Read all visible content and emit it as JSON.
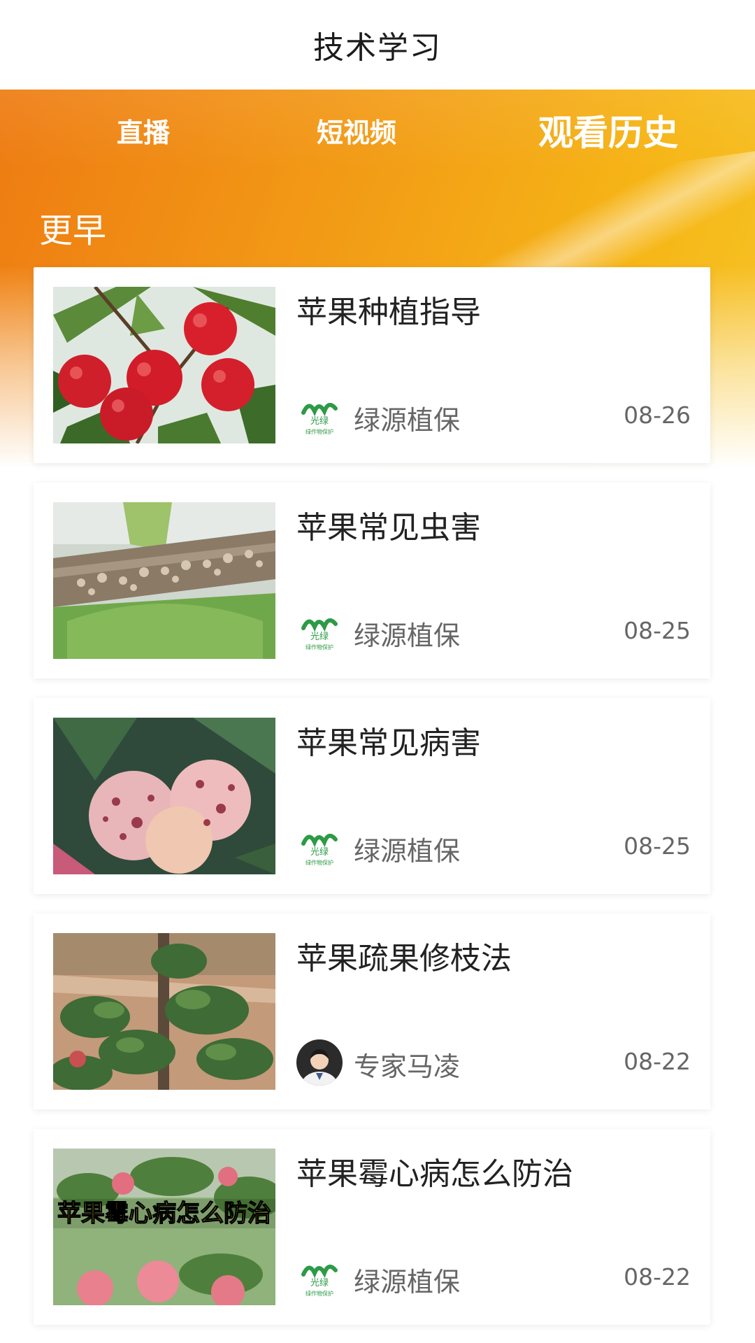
{
  "header": {
    "title": "技术学习"
  },
  "tabs": [
    {
      "label": "直播"
    },
    {
      "label": "短视频"
    },
    {
      "label": "观看历史",
      "active": true
    }
  ],
  "section": {
    "label": "更早"
  },
  "videos": [
    {
      "title": "苹果种植指导",
      "author": "绿源植保",
      "author_icon": "lvyuan-logo",
      "date": "08-26",
      "thumbnail": "red-apples-on-branch"
    },
    {
      "title": "苹果常见虫害",
      "author": "绿源植保",
      "author_icon": "lvyuan-logo",
      "date": "08-25",
      "thumbnail": "branch-with-scale-insects"
    },
    {
      "title": "苹果常见病害",
      "author": "绿源植保",
      "author_icon": "lvyuan-logo",
      "date": "08-25",
      "thumbnail": "spotted-diseased-apples"
    },
    {
      "title": "苹果疏果修枝法",
      "author": "专家马凌",
      "author_icon": "expert-avatar",
      "date": "08-22",
      "thumbnail": "young-apple-orchard"
    },
    {
      "title": "苹果霉心病怎么防治",
      "author": "绿源植保",
      "author_icon": "lvyuan-logo",
      "date": "08-22",
      "thumbnail": "apples-with-caption",
      "thumbnail_caption": "苹果霉心病怎么防治"
    }
  ],
  "logo_text": {
    "top": "光绿",
    "bottom": "绿作物保护"
  },
  "colors": {
    "banner_start": "#ee7b12",
    "banner_end": "#f7c62a",
    "title_text": "#222222",
    "meta_text": "#666666",
    "logo_green": "#2e9a46"
  }
}
